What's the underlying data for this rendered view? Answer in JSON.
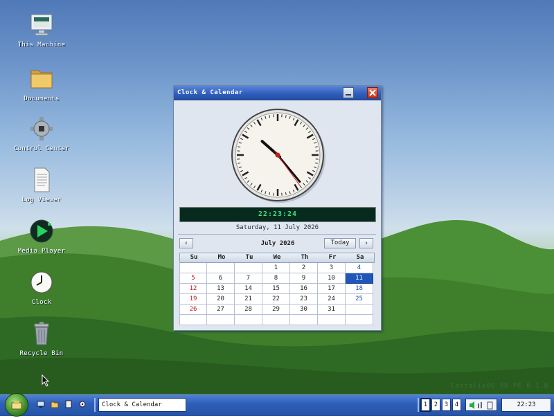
{
  "desktop_icons": [
    {
      "label": "This Machine",
      "icon": "computer-icon"
    },
    {
      "label": "Documents",
      "icon": "folder-icon"
    },
    {
      "label": "Control Center",
      "icon": "gear-icon"
    },
    {
      "label": "Log Viewer",
      "icon": "document-icon"
    },
    {
      "label": "Media Player",
      "icon": "play-icon"
    },
    {
      "label": "Clock",
      "icon": "clock-icon"
    },
    {
      "label": "Recycle Bin",
      "icon": "trash-icon"
    }
  ],
  "os_version": "CastaliaOS 98 PE  0.1.0",
  "window": {
    "title": "Clock & Calendar",
    "digital_time": "22:23:24",
    "date_text": "Saturday, 11 July 2026",
    "analog": {
      "hour": 22,
      "minute": 23,
      "second": 24
    },
    "calendar": {
      "month_label": "July 2026",
      "prev_label": "‹",
      "next_label": "›",
      "today_label": "Today",
      "weekdays": [
        "Su",
        "Mo",
        "Tu",
        "We",
        "Th",
        "Fr",
        "Sa"
      ],
      "weeks": [
        [
          "",
          "",
          "",
          "1",
          "2",
          "3",
          "4"
        ],
        [
          "5",
          "6",
          "7",
          "8",
          "9",
          "10",
          "11"
        ],
        [
          "12",
          "13",
          "14",
          "15",
          "16",
          "17",
          "18"
        ],
        [
          "19",
          "20",
          "21",
          "22",
          "23",
          "24",
          "25"
        ],
        [
          "26",
          "27",
          "28",
          "29",
          "30",
          "31",
          ""
        ],
        [
          "",
          "",
          "",
          "",
          "",
          "",
          ""
        ]
      ],
      "selected_day": "11"
    }
  },
  "taskbar": {
    "task_button_label": "Clock & Calendar",
    "workspaces": [
      "1",
      "2",
      "3",
      "4"
    ],
    "active_workspace": "1",
    "clock": "22:23"
  },
  "colors": {
    "title_blue": "#2d5cbb",
    "close_red": "#c8341d",
    "selected_blue": "#1f56b8",
    "digital_green": "#3fe07a",
    "sunday_red": "#c21d1d",
    "saturday_blue": "#2052a8"
  }
}
